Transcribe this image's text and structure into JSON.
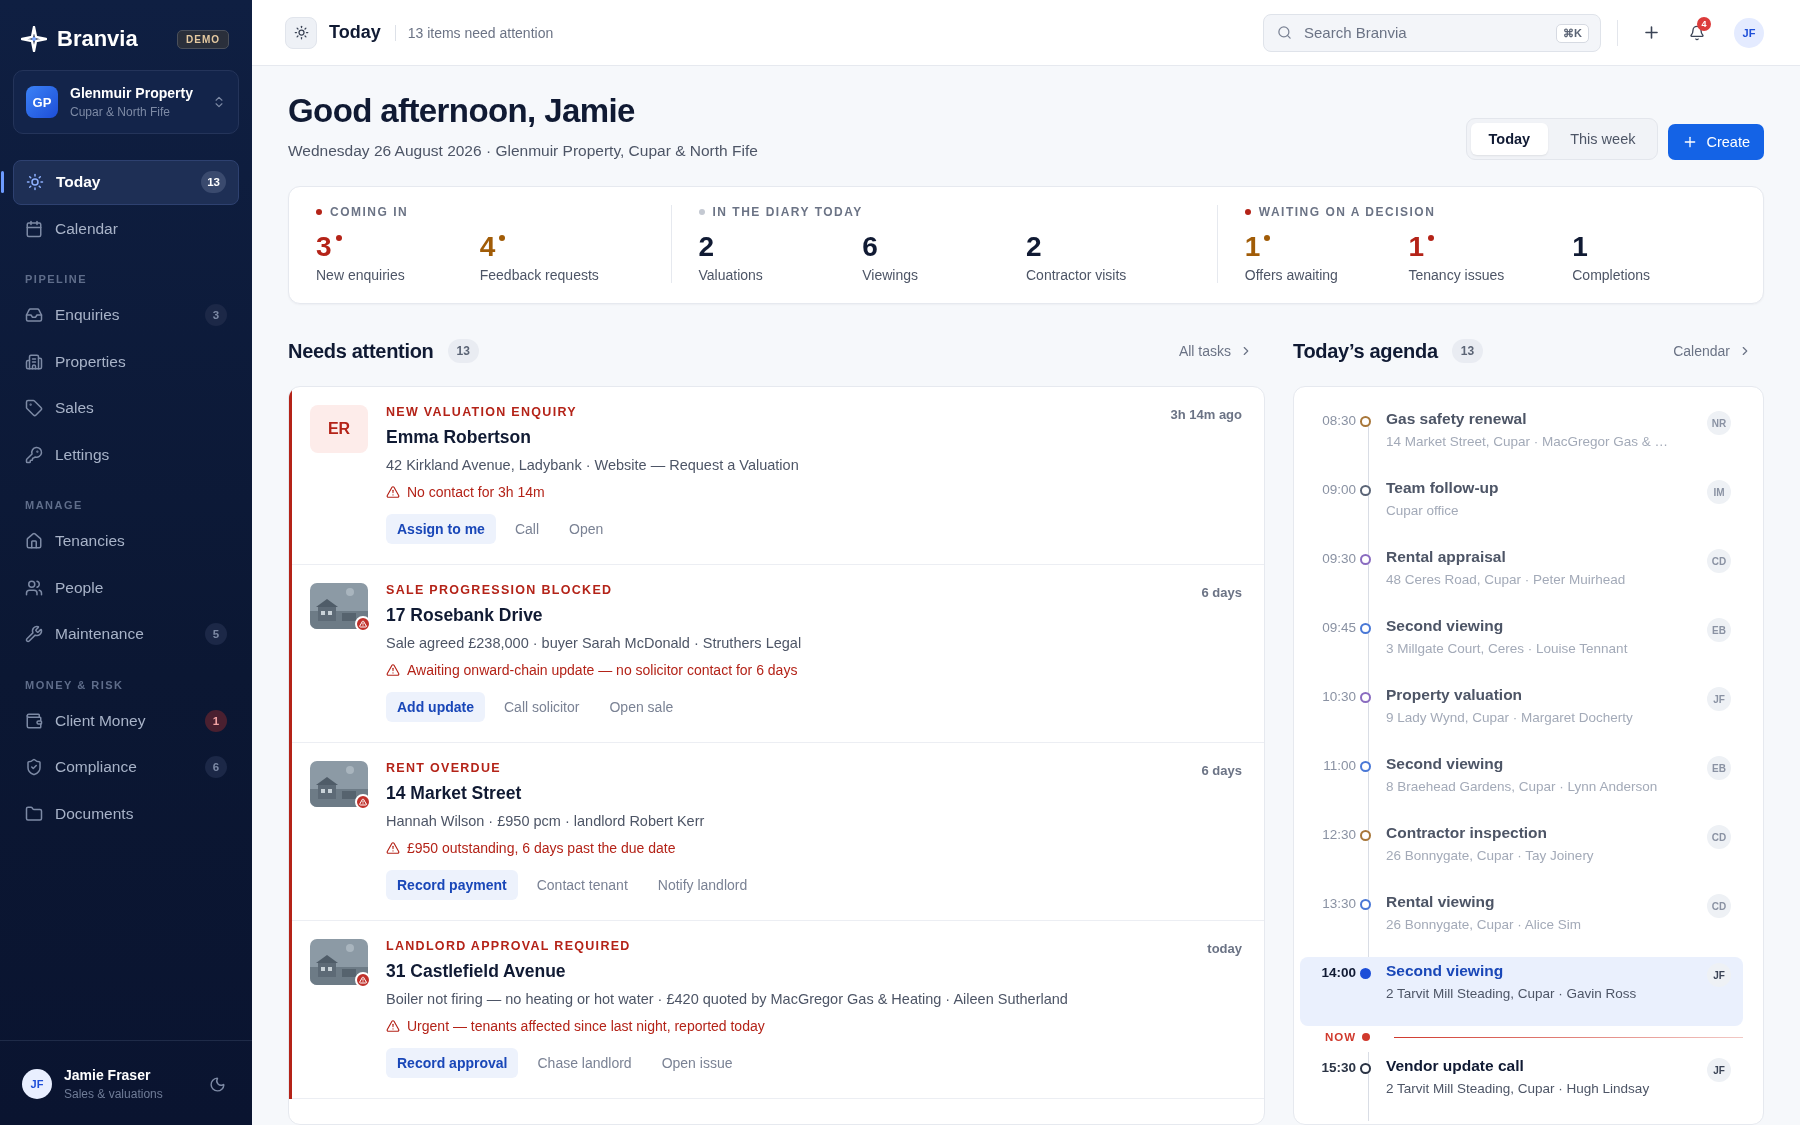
{
  "brand": {
    "name": "Branvia",
    "badge": "DEMO"
  },
  "workspace": {
    "initials": "GP",
    "name": "Glenmuir Property",
    "area": "Cupar & North Fife"
  },
  "nav": [
    {
      "label": "Today",
      "count": "13",
      "selected": true,
      "alert": false
    },
    {
      "label": "Calendar",
      "selected": false
    }
  ],
  "sections": [
    {
      "title": "PIPELINE",
      "items": [
        {
          "label": "Enquiries",
          "count": "3",
          "selected": false,
          "alert": false
        },
        {
          "label": "Properties",
          "selected": false
        },
        {
          "label": "Sales",
          "selected": false
        },
        {
          "label": "Lettings",
          "selected": false
        }
      ]
    },
    {
      "title": "MANAGE",
      "items": [
        {
          "label": "Tenancies",
          "selected": false
        },
        {
          "label": "People",
          "selected": false
        },
        {
          "label": "Maintenance",
          "count": "5",
          "selected": false,
          "alert": false
        }
      ]
    },
    {
      "title": "MONEY & RISK",
      "items": [
        {
          "label": "Client Money",
          "count": "1",
          "selected": false,
          "alert": true
        },
        {
          "label": "Compliance",
          "count": "6",
          "selected": false,
          "alert": false
        },
        {
          "label": "Documents",
          "selected": false
        }
      ]
    }
  ],
  "user": {
    "initials": "JF",
    "name": "Jamie Fraser",
    "role": "Sales & valuations"
  },
  "topbar": {
    "title": "Today",
    "subtitle": "13 items need attention",
    "search": {
      "placeholder": "Search Branvia",
      "shortcut": "⌘K"
    },
    "notifications": "4",
    "avatar": "JF"
  },
  "greeting": {
    "title": "Good afternoon, Jamie",
    "subtitle": "Wednesday 26 August 2026 · Glenmuir Property, Cupar & North Fife"
  },
  "range_tabs": [
    {
      "label": "Today",
      "selected": true
    },
    {
      "label": "This week",
      "selected": false
    }
  ],
  "create_button": "Create",
  "stat_groups": [
    {
      "title": "COMING IN",
      "color": "#b42318",
      "stats": [
        {
          "value": "3",
          "label": "New enquiries",
          "color": "#b42318",
          "flag": true
        },
        {
          "value": "4",
          "label": "Feedback requests",
          "color": "#a15c07",
          "flag": true
        }
      ]
    },
    {
      "title": "IN THE DIARY TODAY",
      "color": "#c4c9d2",
      "stats": [
        {
          "value": "2",
          "label": "Valuations",
          "color": "#101a33",
          "flag": false
        },
        {
          "value": "6",
          "label": "Viewings",
          "color": "#101a33",
          "flag": false
        },
        {
          "value": "2",
          "label": "Contractor visits",
          "color": "#101a33",
          "flag": false
        }
      ]
    },
    {
      "title": "WAITING ON A DECISION",
      "color": "#b42318",
      "stats": [
        {
          "value": "1",
          "label": "Offers awaiting",
          "color": "#a15c07",
          "flag": true
        },
        {
          "value": "1",
          "label": "Tenancy issues",
          "color": "#b42318",
          "flag": true
        },
        {
          "value": "1",
          "label": "Completions",
          "color": "#101a33",
          "flag": false
        }
      ]
    }
  ],
  "needs_attention": {
    "title": "Needs attention",
    "count": "13",
    "link": "All tasks",
    "tasks": [
      {
        "kind": "initials",
        "initials": "ER",
        "color": "#b42318",
        "category": "NEW VALUATION ENQUIRY",
        "title": "Emma Robertson",
        "detail": "42 Kirkland Avenue, Ladybank · Website — Request a Valuation",
        "warning": "No contact for 3h 14m",
        "age": "3h 14m ago",
        "actions": [
          "Assign to me",
          "Call",
          "Open"
        ]
      },
      {
        "kind": "picture",
        "color": "#b42318",
        "category": "SALE PROGRESSION BLOCKED",
        "title": "17 Rosebank Drive",
        "detail": "Sale agreed £238,000 · buyer Sarah McDonald · Struthers Legal",
        "warning": "Awaiting onward-chain update — no solicitor contact for 6 days",
        "age": "6 days",
        "actions": [
          "Add update",
          "Call solicitor",
          "Open sale"
        ]
      },
      {
        "kind": "picture",
        "color": "#b42318",
        "category": "RENT OVERDUE",
        "title": "14 Market Street",
        "detail": "Hannah Wilson · £950 pcm · landlord Robert Kerr",
        "warning": "£950 outstanding, 6 days past the due date",
        "age": "6 days",
        "actions": [
          "Record payment",
          "Contact tenant",
          "Notify landlord"
        ]
      },
      {
        "kind": "picture",
        "color": "#b42318",
        "category": "LANDLORD APPROVAL REQUIRED",
        "title": "31 Castlefield Avenue",
        "detail": "Boiler not firing — no heating or hot water · £420 quoted by MacGregor Gas & Heating · Aileen Sutherland",
        "warning": "Urgent — tenants affected since last night, reported today",
        "age": "today",
        "actions": [
          "Record approval",
          "Chase landlord",
          "Open issue"
        ]
      }
    ]
  },
  "agenda": {
    "title": "Today’s agenda",
    "count": "13",
    "link": "Calendar",
    "now_label": "NOW",
    "items": [
      {
        "time": "08:30",
        "title": "Gas safety renewal",
        "detail": "14 Market Street, Cupar · MacGregor Gas & …",
        "who": "NR",
        "color": "#a8773a",
        "past": true,
        "selected": false,
        "now_after": false
      },
      {
        "time": "09:00",
        "title": "Team follow-up",
        "detail": "Cupar office",
        "who": "IM",
        "color": "#5b6577",
        "past": true,
        "selected": false,
        "now_after": false
      },
      {
        "time": "09:30",
        "title": "Rental appraisal",
        "detail": "48 Ceres Road, Cupar · Peter Muirhead",
        "who": "CD",
        "color": "#8a6cc0",
        "past": true,
        "selected": false,
        "now_after": false
      },
      {
        "time": "09:45",
        "title": "Second viewing",
        "detail": "3 Millgate Court, Ceres · Louise Tennant",
        "who": "EB",
        "color": "#4a78d6",
        "past": true,
        "selected": false,
        "now_after": false
      },
      {
        "time": "10:30",
        "title": "Property valuation",
        "detail": "9 Lady Wynd, Cupar · Margaret Docherty",
        "who": "JF",
        "color": "#8a6cc0",
        "past": true,
        "selected": false,
        "now_after": false
      },
      {
        "time": "11:00",
        "title": "Second viewing",
        "detail": "8 Braehead Gardens, Cupar · Lynn Anderson",
        "who": "EB",
        "color": "#4a78d6",
        "past": true,
        "selected": false,
        "now_after": false
      },
      {
        "time": "12:30",
        "title": "Contractor inspection",
        "detail": "26 Bonnygate, Cupar · Tay Joinery",
        "who": "CD",
        "color": "#a8773a",
        "past": true,
        "selected": false,
        "now_after": false
      },
      {
        "time": "13:30",
        "title": "Rental viewing",
        "detail": "26 Bonnygate, Cupar · Alice Sim",
        "who": "CD",
        "color": "#4a78d6",
        "past": true,
        "selected": false,
        "now_after": false
      },
      {
        "time": "14:00",
        "title": "Second viewing",
        "detail": "2 Tarvit Mill Steading, Cupar · Gavin Ross",
        "who": "JF",
        "color": "#1d4ed8",
        "past": false,
        "selected": true,
        "now_after": true
      },
      {
        "time": "15:30",
        "title": "Vendor update call",
        "detail": "2 Tarvit Mill Steading, Cupar · Hugh Lindsay",
        "who": "JF",
        "color": "#2b3445",
        "past": false,
        "selected": false,
        "now_after": false
      }
    ]
  }
}
